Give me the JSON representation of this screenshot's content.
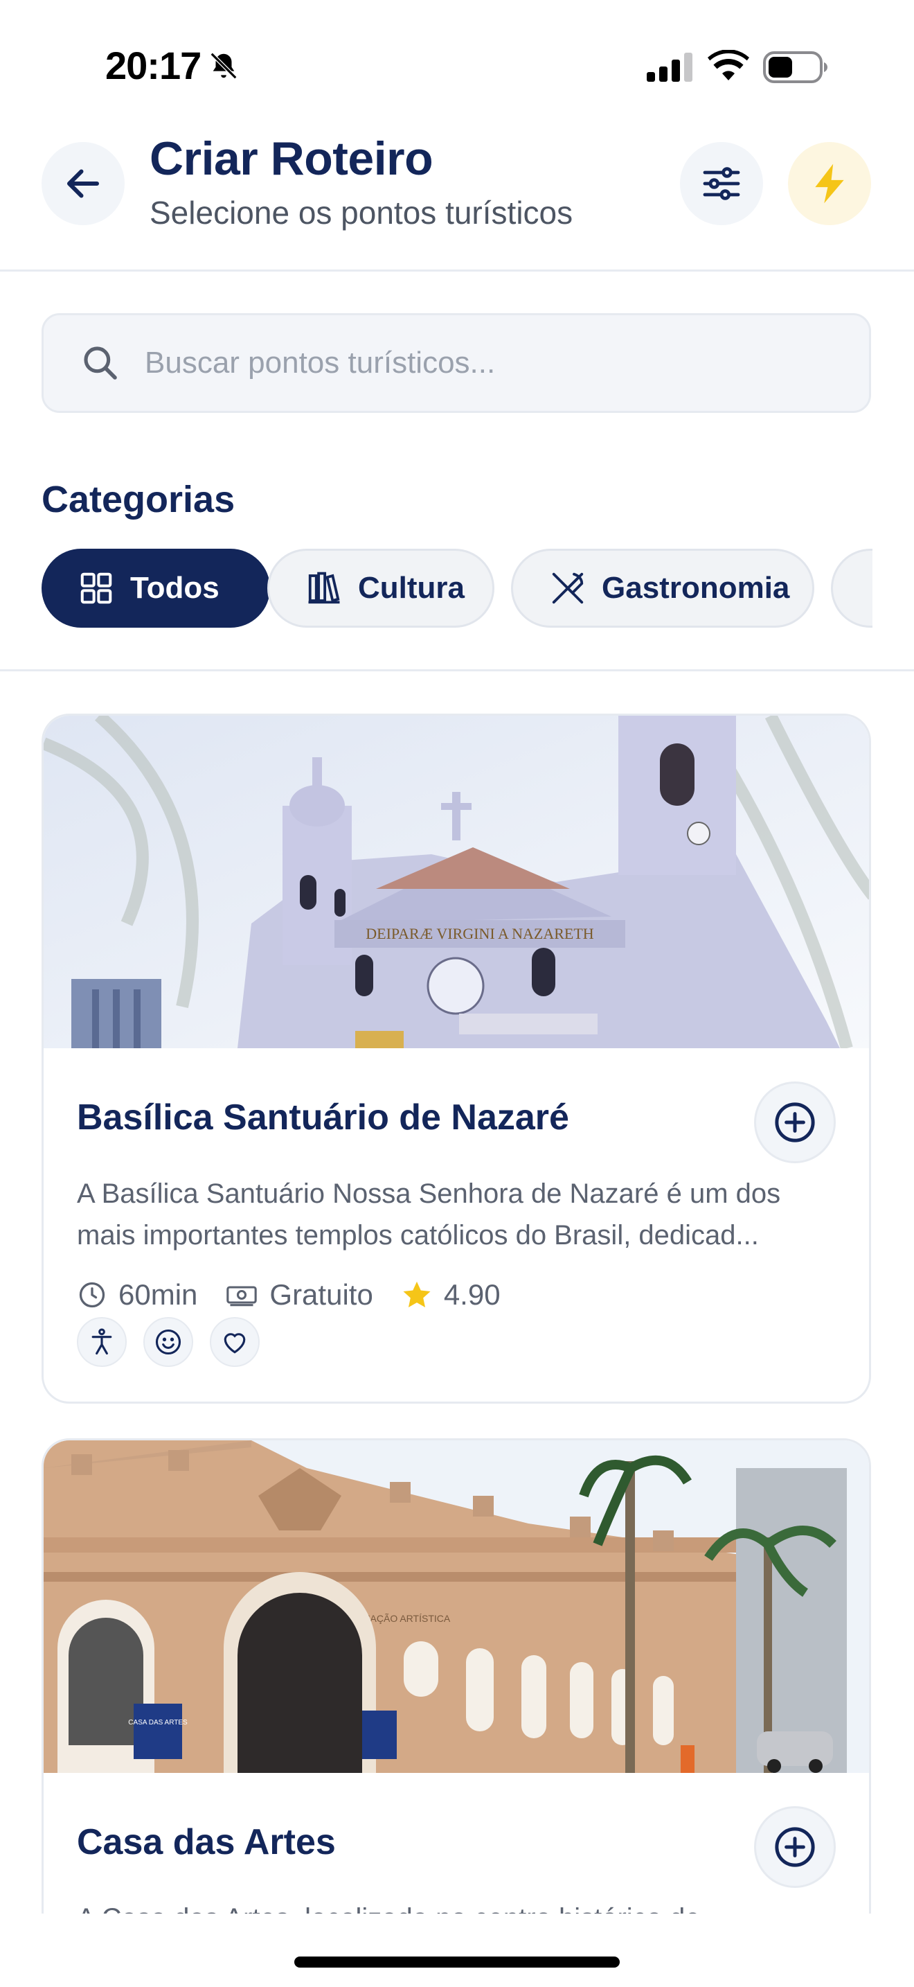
{
  "status_bar": {
    "time": "20:17"
  },
  "header": {
    "title": "Criar Roteiro",
    "subtitle": "Selecione os pontos turísticos",
    "back_icon": "arrow-left-icon",
    "filter_icon": "sliders-icon",
    "quick_icon": "lightning-icon"
  },
  "search": {
    "placeholder": "Buscar pontos turísticos...",
    "value": ""
  },
  "categories": {
    "title": "Categorias",
    "items": [
      {
        "label": "Todos",
        "icon": "grid-icon",
        "active": true
      },
      {
        "label": "Cultura",
        "icon": "library-icon",
        "active": false
      },
      {
        "label": "Gastronomia",
        "icon": "utensils-icon",
        "active": false
      },
      {
        "label": "",
        "icon": "partial-chip",
        "active": false
      }
    ]
  },
  "places": [
    {
      "name": "Basílica Santuário de Nazaré",
      "description": "A Basílica Santuário Nossa Senhora de Nazaré é um dos mais importantes templos católicos do Brasil, dedicad...",
      "duration": "60min",
      "price": "Gratuito",
      "rating": "4.90",
      "image_caption": "DEIPARÆ VIRGINI A NAZARETH",
      "accessibility_icons": [
        "accessibility-icon",
        "smile-icon",
        "heart-icon"
      ]
    },
    {
      "name": "Casa das Artes",
      "description": "A Casa das Artes, localizada no centro histórico de",
      "image_caption": "CENTRO DE INFORMAÇÃO ARTÍSTICA",
      "sign_text": "CASA DAS ARTES"
    }
  ],
  "colors": {
    "navy": "#13265a",
    "accent_yellow": "#f5c518",
    "muted": "#5b6270"
  }
}
